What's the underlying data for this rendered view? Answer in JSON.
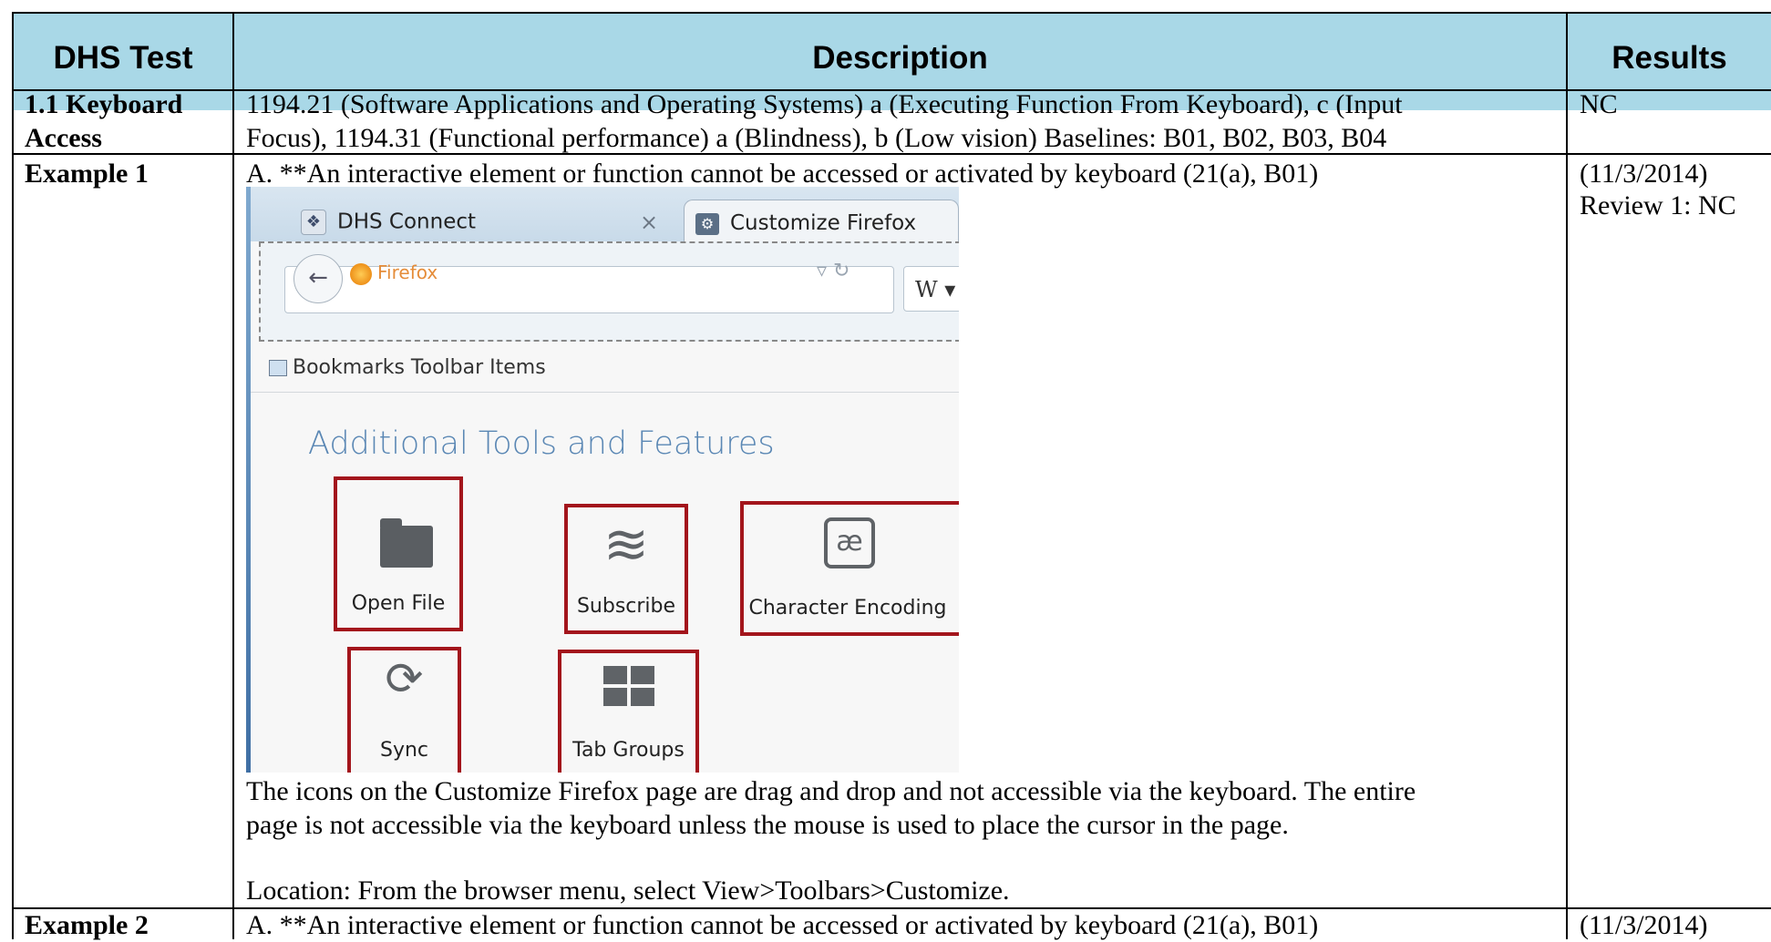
{
  "table": {
    "headers": {
      "test": "DHS Test",
      "description": "Description",
      "results": "Results"
    },
    "row_1_1": {
      "test": "1.1 Keyboard Access",
      "test_line1": "1.1 Keyboard",
      "test_line2": "Access",
      "description_line1": "1194.21 (Software Applications and Operating Systems) a (Executing Function From Keyboard), c (Input",
      "description_line2": "Focus), 1194.31 (Functional performance) a (Blindness), b (Low vision) Baselines: B01, B02, B03, B04",
      "result": "NC"
    },
    "example_1": {
      "test": "Example 1",
      "description_heading": "A. **An interactive element or function cannot be accessed or activated by keyboard (21(a), B01)",
      "caption_line1": "The icons on the Customize Firefox page are drag and drop and not accessible via the keyboard. The entire",
      "caption_line2": "page is not accessible via the keyboard unless the mouse is used to place the cursor in the page.",
      "location": "Location: From the browser menu, select View>Toolbars>Customize.",
      "result_date": "(11/3/2014)",
      "result_review": "Review 1: NC"
    },
    "example_2": {
      "test": "Example 2",
      "description_heading": "A. **An interactive element or function cannot be accessed or activated by keyboard (21(a), B01)",
      "result_date": "(11/3/2014)"
    }
  },
  "screenshot": {
    "tabs": [
      {
        "label": "DHS Connect",
        "icon": "dhs-shield-icon",
        "close": "×"
      },
      {
        "label": "Customize Firefox",
        "icon": "gear-icon"
      }
    ],
    "url_text": "Firefox",
    "search_engine": "W",
    "bookmarks_label": "Bookmarks Toolbar Items",
    "section_title": "Additional Tools and Features",
    "tools": [
      {
        "label": "Open File",
        "icon": "folder-icon"
      },
      {
        "label": "Subscribe",
        "icon": "rss-icon"
      },
      {
        "label": "Character Encoding",
        "icon": "ae-icon"
      },
      {
        "label": "Sync",
        "icon": "sync-icon"
      },
      {
        "label": "Tab Groups",
        "icon": "tab-groups-icon"
      }
    ],
    "highlight_color": "#a3151c"
  },
  "colors": {
    "header_background": "#a9d8e7"
  }
}
